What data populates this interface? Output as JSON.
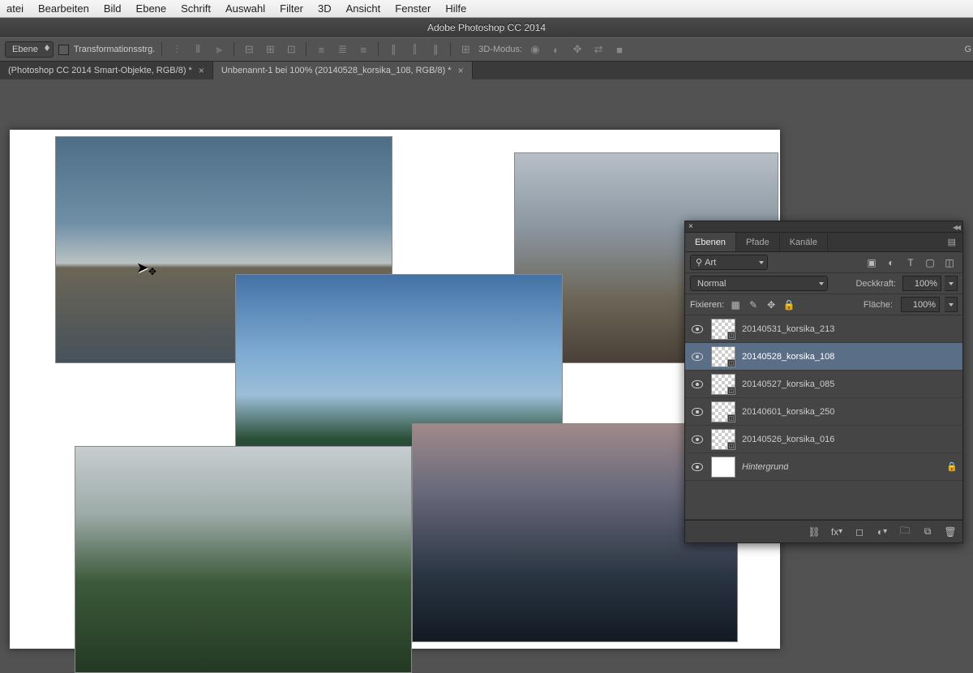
{
  "menubar": [
    "atei",
    "Bearbeiten",
    "Bild",
    "Ebene",
    "Schrift",
    "Auswahl",
    "Filter",
    "3D",
    "Ansicht",
    "Fenster",
    "Hilfe"
  ],
  "window_title": "Adobe Photoshop CC 2014",
  "options_bar": {
    "scope_label": "Ebene",
    "transform_checkbox_label": "Transformationsstrg.",
    "mode_3d_label": "3D-Modus:"
  },
  "right_truncated": "G",
  "tabs": [
    {
      "label": "(Photoshop CC 2014  Smart-Objekte, RGB/8) *",
      "active": false
    },
    {
      "label": "Unbenannt-1 bei 100% (20140528_korsika_108, RGB/8) *",
      "active": true
    }
  ],
  "layers_panel": {
    "tabs": [
      "Ebenen",
      "Pfade",
      "Kanäle"
    ],
    "active_tab": "Ebenen",
    "filter_label": "Art",
    "search_icon": "⚲",
    "blend_mode": "Normal",
    "opacity_label": "Deckkraft:",
    "opacity_value": "100%",
    "lock_label": "Fixieren:",
    "fill_label": "Fläche:",
    "fill_value": "100%",
    "layers": [
      {
        "name": "20140531_korsika_213",
        "smart": true,
        "selected": false,
        "bg": false
      },
      {
        "name": "20140528_korsika_108",
        "smart": true,
        "selected": true,
        "bg": false
      },
      {
        "name": "20140527_korsika_085",
        "smart": true,
        "selected": false,
        "bg": false
      },
      {
        "name": "20140601_korsika_250",
        "smart": true,
        "selected": false,
        "bg": false
      },
      {
        "name": "20140526_korsika_016",
        "smart": true,
        "selected": false,
        "bg": false
      },
      {
        "name": "Hintergrund",
        "smart": false,
        "selected": false,
        "bg": true
      }
    ]
  }
}
